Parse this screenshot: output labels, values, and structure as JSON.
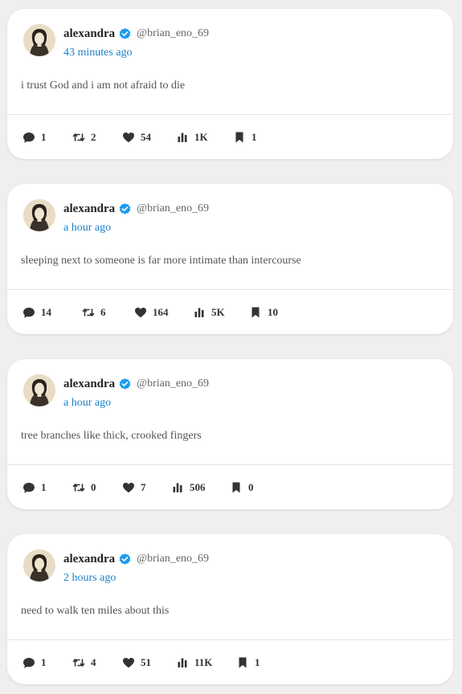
{
  "posts": [
    {
      "author": {
        "name": "alexandra",
        "handle": "@brian_eno_69",
        "verified": true
      },
      "time": "43 minutes ago",
      "text": "i trust God and i am not afraid to die",
      "stats": {
        "replies": "1",
        "reposts": "2",
        "likes": "54",
        "views": "1K",
        "bookmarks": "1"
      }
    },
    {
      "author": {
        "name": "alexandra",
        "handle": "@brian_eno_69",
        "verified": true
      },
      "time": "a hour ago",
      "text": "sleeping next to someone is far more intimate than intercourse",
      "stats": {
        "replies": "14",
        "reposts": "6",
        "likes": "164",
        "views": "5K",
        "bookmarks": "10"
      }
    },
    {
      "author": {
        "name": "alexandra",
        "handle": "@brian_eno_69",
        "verified": true
      },
      "time": "a hour ago",
      "text": "tree branches like thick, crooked fingers",
      "stats": {
        "replies": "1",
        "reposts": "0",
        "likes": "7",
        "views": "506",
        "bookmarks": "0"
      }
    },
    {
      "author": {
        "name": "alexandra",
        "handle": "@brian_eno_69",
        "verified": true
      },
      "time": "2 hours ago",
      "text": "need to walk ten miles about this",
      "stats": {
        "replies": "1",
        "reposts": "4",
        "likes": "51",
        "views": "11K",
        "bookmarks": "1"
      }
    }
  ],
  "icons": {
    "reply": "reply-icon",
    "repost": "repost-icon",
    "like": "heart-icon",
    "views": "views-icon",
    "bookmark": "bookmark-icon",
    "verified": "verified-badge-icon",
    "avatar": "avatar-portrait"
  },
  "colors": {
    "background": "#efefef",
    "card": "#ffffff",
    "link": "#1a7fc7",
    "verified": "#1d9bf0",
    "icon": "#333333"
  }
}
